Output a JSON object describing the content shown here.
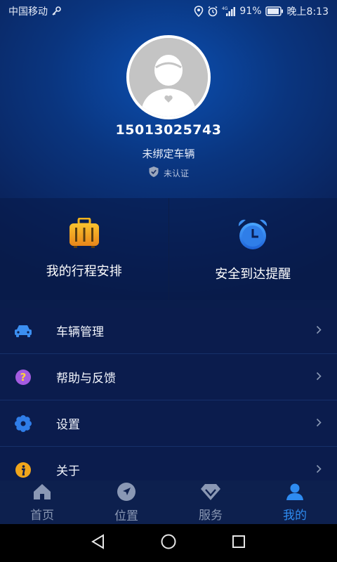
{
  "status_bar": {
    "carrier": "中国移动",
    "battery_percent": "91%",
    "time": "晚上8:13",
    "network_label": "4G"
  },
  "profile": {
    "phone": "15013025743",
    "vehicle_status": "未绑定车辆",
    "verify_status": "未认证"
  },
  "tiles": [
    {
      "label": "我的行程安排",
      "icon": "luggage-icon"
    },
    {
      "label": "安全到达提醒",
      "icon": "alarm-clock-icon"
    }
  ],
  "menu": [
    {
      "label": "车辆管理",
      "icon": "car-icon",
      "color": "#3b8ef0"
    },
    {
      "label": "帮助与反馈",
      "icon": "question-icon",
      "color": "#a45ce0"
    },
    {
      "label": "设置",
      "icon": "gear-icon",
      "color": "#2f7de8"
    },
    {
      "label": "关于",
      "icon": "info-icon",
      "color": "#f0a51c"
    }
  ],
  "bottom_nav": [
    {
      "label": "首页",
      "icon": "home-icon",
      "active": false
    },
    {
      "label": "位置",
      "icon": "navigation-icon",
      "active": false
    },
    {
      "label": "服务",
      "icon": "diamond-icon",
      "active": false
    },
    {
      "label": "我的",
      "icon": "user-icon",
      "active": true
    }
  ],
  "colors": {
    "accent": "#2e8bf0",
    "inactive": "#8a98b4",
    "background": "#0b1c4d"
  }
}
